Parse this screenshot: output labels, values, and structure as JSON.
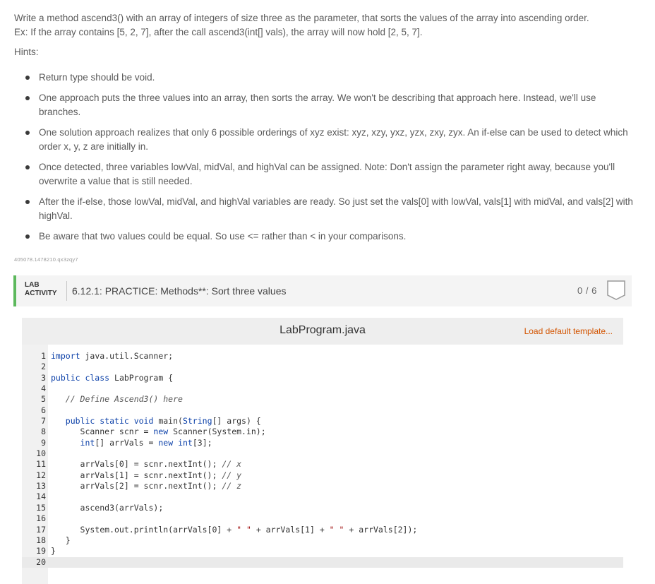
{
  "prompt": {
    "line1": "Write a method ascend3() with an array of integers of size three as the parameter, that sorts the values of the array into ascending order.",
    "line2": "Ex: If the array contains [5, 2, 7], after the call ascend3(int[] vals), the array will now hold [2, 5, 7]."
  },
  "hints_label": "Hints:",
  "hints": [
    "Return type should be void.",
    "One approach puts the three values into an array, then sorts the array. We won't be describing that approach here. Instead, we'll use branches.",
    "One solution approach realizes that only 6 possible orderings of xyz exist: xyz, xzy, yxz, yzx, zxy, zyx. An if-else can be used to detect which order x, y, z are initially in.",
    "Once detected, three variables lowVal, midVal, and highVal can be assigned. Note: Don't assign the parameter right away, because you'll overwrite a value that is still needed.",
    "After the if-else, those lowVal, midVal, and highVal variables are ready. So just set the vals[0] with lowVal, vals[1] with midVal, and vals[2] with highVal.",
    "Be aware that two values could be equal. So use <= rather than < in your comparisons."
  ],
  "identifier": "405078.1478210.qx3zqy7",
  "lab": {
    "label_line1": "LAB",
    "label_line2": "ACTIVITY",
    "title": "6.12.1: PRACTICE: Methods**: Sort three values",
    "score": "0 / 6"
  },
  "editor": {
    "filename": "LabProgram.java",
    "load_default": "Load default template...",
    "line_numbers": [
      "1",
      "2",
      "3",
      "4",
      "5",
      "6",
      "7",
      "8",
      "9",
      "10",
      "11",
      "12",
      "13",
      "14",
      "15",
      "16",
      "17",
      "18",
      "19",
      "20"
    ]
  },
  "colors": {
    "accent_green": "#5cb85c",
    "link_orange": "#d35400",
    "keyword_blue": "#0a3fa8"
  }
}
